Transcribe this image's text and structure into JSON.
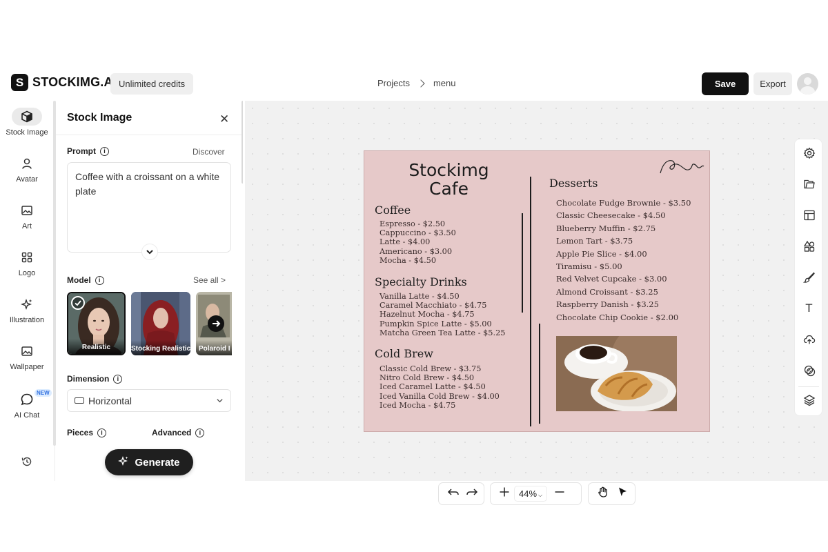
{
  "header": {
    "logo_mark": "S",
    "logo_text": "STOCKIMG.AI",
    "credits": "Unlimited credits",
    "breadcrumb": [
      "Projects",
      "menu"
    ],
    "save_label": "Save",
    "export_label": "Export"
  },
  "rail": {
    "items": [
      {
        "label": "Stock Image",
        "icon": "cube-icon"
      },
      {
        "label": "Avatar",
        "icon": "user-icon"
      },
      {
        "label": "Art",
        "icon": "image-icon"
      },
      {
        "label": "Logo",
        "icon": "grid-icon"
      },
      {
        "label": "Illustration",
        "icon": "sparkle-icon"
      },
      {
        "label": "Wallpaper",
        "icon": "image-icon"
      },
      {
        "label": "AI Chat",
        "icon": "chat-icon"
      }
    ],
    "new_badge": "NEW",
    "history_icon": "history-icon"
  },
  "panel": {
    "title": "Stock Image",
    "prompt_label": "Prompt",
    "discover": "Discover",
    "prompt_value": "Coffee with a croissant on a white plate",
    "model_label": "Model",
    "see_all": "See all >",
    "models": [
      "Realistic",
      "Stocking Realistic",
      "Polaroid I"
    ],
    "dimension_label": "Dimension",
    "dimension_value": "Horizontal",
    "pieces_label": "Pieces",
    "advanced_label": "Advanced",
    "generate_label": "Generate"
  },
  "menu": {
    "title_line1": "Stockimg",
    "title_line2": "Cafe",
    "coffee_title": "Coffee",
    "coffee_items": [
      "Espresso - $2.50",
      "Cappuccino - $3.50",
      "Latte - $4.00",
      "Americano - $3.00",
      "Mocha - $4.50"
    ],
    "specialty_title": "Specialty Drinks",
    "specialty_items": [
      "Vanilla Latte - $4.50",
      "Caramel Macchiato - $4.75",
      "Hazelnut Mocha - $4.75",
      "Pumpkin Spice Latte - $5.00",
      "Matcha Green Tea Latte - $5.25"
    ],
    "coldbrew_title": "Cold Brew",
    "coldbrew_items": [
      "Classic Cold Brew - $3.75",
      "Nitro Cold Brew - $4.50",
      "Iced Caramel Latte - $4.50",
      "Iced Vanilla Cold Brew - $4.00",
      "Iced Mocha - $4.75"
    ],
    "desserts_title": "Desserts",
    "dessert_items": [
      "Chocolate Fudge Brownie - $3.50",
      "Classic Cheesecake - $4.50",
      "Blueberry Muffin - $2.75",
      "Lemon Tart - $3.75",
      "Apple Pie Slice - $4.00",
      "Tiramisu - $5.00",
      "Red Velvet Cupcake - $3.00",
      "Almond Croissant - $3.25",
      "Raspberry Danish - $3.25",
      "Chocolate Chip Cookie - $2.00"
    ]
  },
  "toolbar": {
    "zoom": "44%"
  },
  "colors": {
    "menu_background": "#e6c9c9",
    "primary_button": "#111111"
  }
}
